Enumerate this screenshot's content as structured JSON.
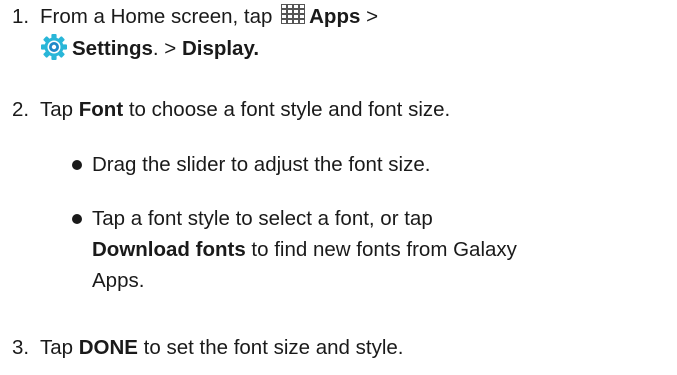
{
  "steps": [
    {
      "num": "1.",
      "line1_pre": "From a Home screen, tap ",
      "apps_icon": "apps-grid-icon",
      "apps": "Apps",
      "sep1": " >",
      "settings_icon": "settings-gear-icon",
      "settings": "Settings",
      "sep2": ". > ",
      "display": "Display."
    },
    {
      "num": "2.",
      "tap": "Tap ",
      "font": "Font",
      "rest": " to choose a font style and font size."
    },
    {
      "num": "3.",
      "tap": "Tap ",
      "done": "DONE",
      "rest": " to set the font size and style."
    }
  ],
  "bullets": [
    {
      "text": "Drag the slider to adjust the font size."
    },
    {
      "line1": "Tap a font style to select a font, or tap",
      "download": "Download fonts",
      "line2_rest": " to find new fonts from Galaxy",
      "line3": "Apps."
    }
  ],
  "colors": {
    "text": "#1a1a1a",
    "icon_grid": "#555555",
    "icon_gear_outer": "#29b6d8",
    "icon_gear_inner": "#1e88c8"
  }
}
